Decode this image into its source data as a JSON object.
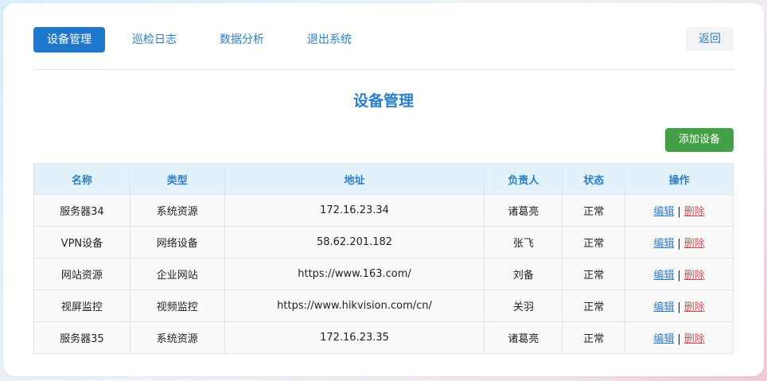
{
  "nav": {
    "items": [
      "设备管理",
      "巡检日志",
      "数据分析",
      "退出系统"
    ],
    "active_index": 0,
    "back_label": "返回"
  },
  "page": {
    "title": "设备管理",
    "add_button": "添加设备"
  },
  "table": {
    "headers": [
      "名称",
      "类型",
      "地址",
      "负责人",
      "状态",
      "操作"
    ],
    "rows": [
      {
        "name": "服务器34",
        "type": "系统资源",
        "address": "172.16.23.34",
        "owner": "诸葛亮",
        "status": "正常"
      },
      {
        "name": "VPN设备",
        "type": "网络设备",
        "address": "58.62.201.182",
        "owner": "张飞",
        "status": "正常"
      },
      {
        "name": "网站资源",
        "type": "企业网站",
        "address": "https://www.163.com/",
        "owner": "刘备",
        "status": "正常"
      },
      {
        "name": "视屏监控",
        "type": "视频监控",
        "address": "https://www.hikvision.com/cn/",
        "owner": "关羽",
        "status": "正常"
      },
      {
        "name": "服务器35",
        "type": "系统资源",
        "address": "172.16.23.35",
        "owner": "诸葛亮",
        "status": "正常"
      }
    ],
    "action_edit": "编辑",
    "action_sep": "|",
    "action_delete": "删除"
  },
  "colors": {
    "accent": "#1f78cc",
    "link": "#2b7fc9",
    "add": "#43a047",
    "delete": "#e24b4b"
  }
}
